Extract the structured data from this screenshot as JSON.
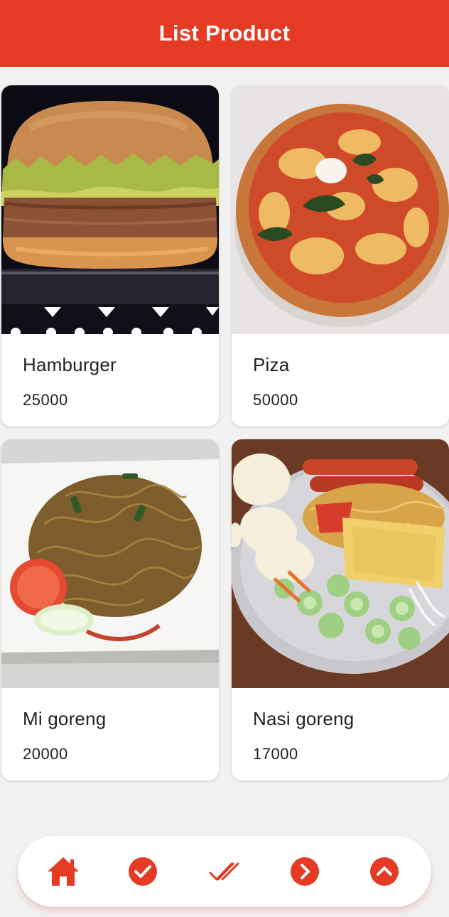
{
  "appbar": {
    "title": "List Product",
    "color": "#e53a24"
  },
  "products": [
    {
      "name": "Hamburger",
      "price": "25000",
      "image": "hamburger-image"
    },
    {
      "name": "Piza",
      "price": "50000",
      "image": "pizza-image"
    },
    {
      "name": "Mi goreng",
      "price": "20000",
      "image": "mi-goreng-image"
    },
    {
      "name": "Nasi goreng",
      "price": "17000",
      "image": "nasi-goreng-image"
    }
  ],
  "bottom_nav": {
    "active_index": 2,
    "items": [
      {
        "icon": "home-icon"
      },
      {
        "icon": "check-circle-icon"
      },
      {
        "icon": "double-check-icon"
      },
      {
        "icon": "chevron-right-circle-icon"
      },
      {
        "icon": "chevron-up-circle-icon"
      }
    ]
  }
}
